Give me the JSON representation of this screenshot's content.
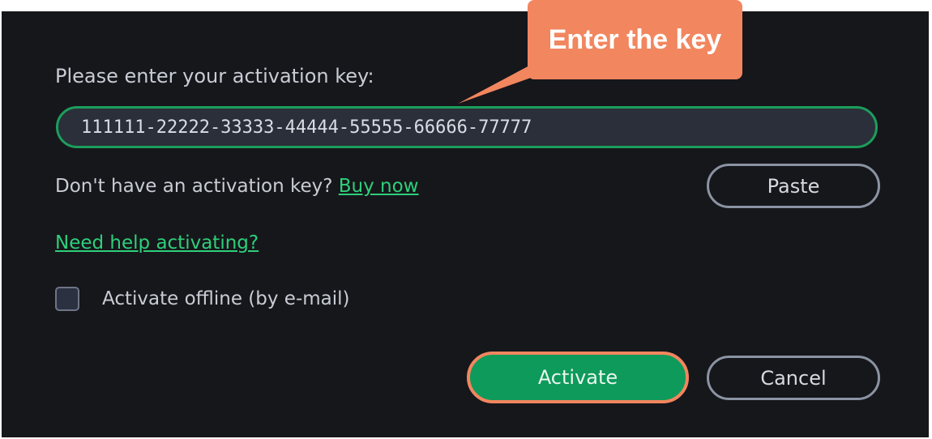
{
  "dialog": {
    "prompt_label": "Please enter your activation key:",
    "key_value": "111111-22222-33333-44444-55555-66666-77777",
    "no_key_text": "Don't have an activation key?",
    "buy_now_label": "Buy now",
    "paste_label": "Paste",
    "help_link_label": "Need help activating?",
    "offline_checkbox": {
      "label": "Activate offline (by e-mail)",
      "checked": false
    },
    "activate_label": "Activate",
    "cancel_label": "Cancel"
  },
  "callout": {
    "text": "Enter the key",
    "color": "#f2865f"
  },
  "colors": {
    "background": "#16171b",
    "accent": "#1c9e5c",
    "link": "#2ecf7a",
    "highlight": "#f2865f"
  }
}
